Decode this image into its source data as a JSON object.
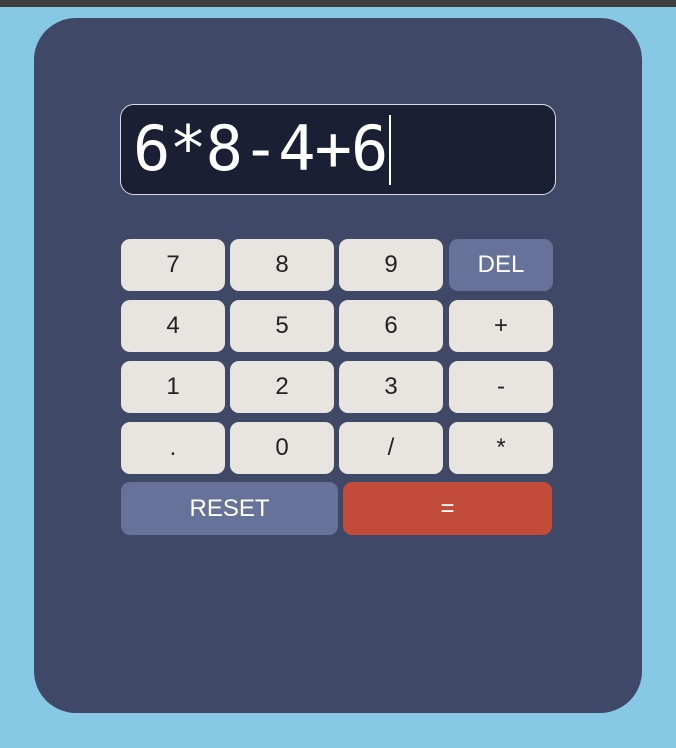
{
  "display": {
    "expression": "6*8-4+6"
  },
  "keys": {
    "row1": [
      "7",
      "8",
      "9",
      "DEL"
    ],
    "row2": [
      "4",
      "5",
      "6",
      "+"
    ],
    "row3": [
      "1",
      "2",
      "3",
      "-"
    ],
    "row4": [
      ".",
      "0",
      "/",
      "*"
    ],
    "reset": "RESET",
    "equals": "="
  },
  "colors": {
    "background": "#87c9e4",
    "calculator_body": "#3f4866",
    "display_background": "#1b1f33",
    "key_default": "#e8e4df",
    "key_accent": "#67729a",
    "key_equals": "#c24b3a"
  }
}
